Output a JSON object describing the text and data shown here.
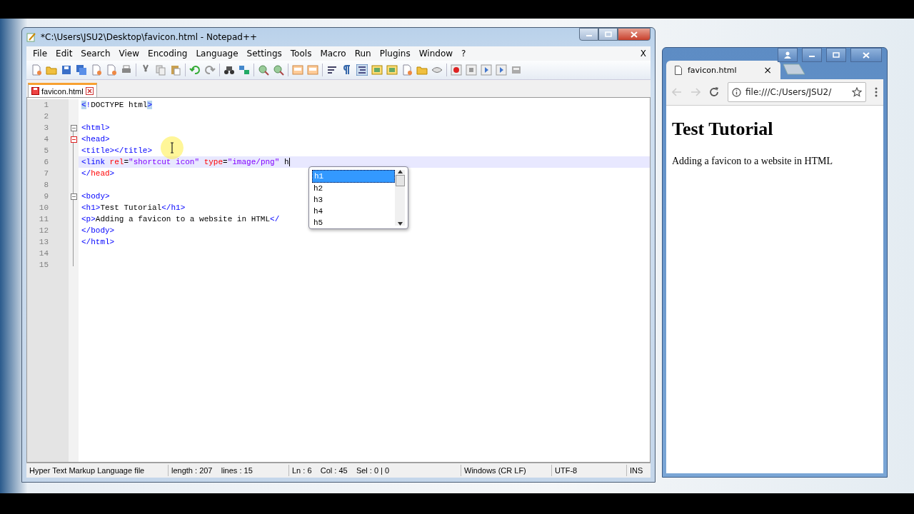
{
  "editor_window": {
    "title": "*C:\\Users\\JSU2\\Desktop\\favicon.html - Notepad++",
    "menu": [
      "File",
      "Edit",
      "Search",
      "View",
      "Encoding",
      "Language",
      "Settings",
      "Tools",
      "Macro",
      "Run",
      "Plugins",
      "Window",
      "?"
    ],
    "close_doc": "X",
    "tabs": [
      {
        "label": "favicon.html",
        "selected": true,
        "modified": true
      }
    ],
    "lines": [
      {
        "number": "1",
        "fold_open": false,
        "current": false,
        "tokens": [
          {
            "kind": "tag",
            "text": "<",
            "match": true
          },
          {
            "kind": "tag",
            "text": "!",
            "match": false
          },
          {
            "kind": "plain",
            "text": "DOCTYPE html",
            "match": false
          },
          {
            "kind": "tag",
            "text": ">",
            "match": true
          }
        ]
      },
      {
        "number": "2",
        "fold_open": false,
        "current": false
      },
      {
        "number": "3",
        "fold_open": true,
        "fold_active": false,
        "current": false,
        "tokens": [
          {
            "kind": "tag",
            "text": "<html>",
            "match": false
          }
        ]
      },
      {
        "number": "4",
        "fold_open": true,
        "fold_active": true,
        "current": false,
        "tokens": [
          {
            "kind": "tag",
            "text": "<head>",
            "match": false
          }
        ]
      },
      {
        "number": "5",
        "fold_open": false,
        "current": false,
        "tokens": [
          {
            "kind": "tag",
            "text": "<title></title>",
            "match": false
          }
        ]
      },
      {
        "number": "6",
        "fold_open": false,
        "current": true,
        "tokens": [
          {
            "kind": "tag",
            "text": "<link ",
            "match": false
          },
          {
            "kind": "attr",
            "text": "rel",
            "match": false
          },
          {
            "kind": "plain",
            "text": "=",
            "match": false
          },
          {
            "kind": "string",
            "text": "\"shortcut icon\" ",
            "match": false
          },
          {
            "kind": "attr",
            "text": "type",
            "match": false
          },
          {
            "kind": "plain",
            "text": "=",
            "match": false
          },
          {
            "kind": "string",
            "text": "\"image/png\" ",
            "match": false
          },
          {
            "kind": "plain",
            "text": "h",
            "match": false
          }
        ]
      },
      {
        "number": "7",
        "fold_open": false,
        "current": false,
        "tokens": [
          {
            "kind": "tag",
            "text": "</",
            "match": false
          },
          {
            "kind": "attr",
            "text": "head",
            "match": false
          },
          {
            "kind": "tag",
            "text": ">",
            "match": false
          }
        ]
      },
      {
        "number": "8",
        "fold_open": false,
        "current": false
      },
      {
        "number": "9",
        "fold_open": true,
        "fold_active": false,
        "current": false,
        "tokens": [
          {
            "kind": "tag",
            "text": "<body>",
            "match": false
          }
        ]
      },
      {
        "number": "10",
        "fold_open": false,
        "current": false,
        "tokens": [
          {
            "kind": "tag",
            "text": "<h1>",
            "match": false
          },
          {
            "kind": "plain",
            "text": "Test Tutorial",
            "match": false
          },
          {
            "kind": "tag",
            "text": "</h1>",
            "match": false
          }
        ]
      },
      {
        "number": "11",
        "fold_open": false,
        "current": false,
        "tokens": [
          {
            "kind": "tag",
            "text": "<p>",
            "match": false
          },
          {
            "kind": "plain",
            "text": "Adding a favicon to a website in HTML",
            "match": false
          },
          {
            "kind": "tag",
            "text": "</",
            "match": false
          }
        ]
      },
      {
        "number": "12",
        "fold_open": false,
        "current": false,
        "tokens": [
          {
            "kind": "tag",
            "text": "</body>",
            "match": false
          }
        ]
      },
      {
        "number": "13",
        "fold_open": false,
        "current": false,
        "tokens": [
          {
            "kind": "tag",
            "text": "</html>",
            "match": false
          }
        ]
      },
      {
        "number": "14",
        "fold_open": false,
        "current": false
      },
      {
        "number": "15",
        "fold_open": false,
        "current": false
      }
    ],
    "autocomplete": [
      {
        "label": "h1",
        "selected": true
      },
      {
        "label": "h2",
        "selected": false
      },
      {
        "label": "h3",
        "selected": false
      },
      {
        "label": "h4",
        "selected": false
      },
      {
        "label": "h5",
        "selected": false
      }
    ],
    "status_bar": [
      "Hyper Text Markup Language file",
      "length : 207    lines : 15",
      "Ln : 6    Col : 45    Sel : 0 | 0",
      "Windows (CR LF)",
      "UTF-8",
      "INS"
    ]
  },
  "browser_window": {
    "tab": {
      "label": "favicon.html",
      "close": "×"
    },
    "address": "file:///C:/Users/JSU2/",
    "heading": "Test Tutorial",
    "paragraph": "Adding a favicon to a website in HTML"
  }
}
